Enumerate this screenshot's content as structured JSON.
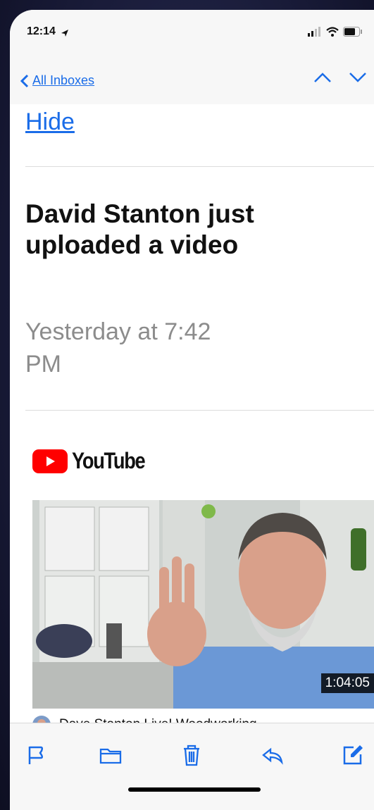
{
  "status_bar": {
    "time": "12:14"
  },
  "nav": {
    "back_label": "All Inboxes"
  },
  "email": {
    "hide_label": "Hide",
    "title": "David Stanton just uploaded a video",
    "date": "Yesterday at 7:42 PM"
  },
  "brand": {
    "name": "YouTube",
    "color": "#ff0000"
  },
  "video": {
    "duration": "1:04:05",
    "channel_text": "Dave Stanton Live! Woodworking,"
  },
  "toolbar": {
    "icons": [
      "flag-icon",
      "folder-icon",
      "trash-icon",
      "reply-icon",
      "compose-icon"
    ]
  },
  "colors": {
    "link": "#1a6ce8",
    "muted": "#8c8c8c",
    "background": "#1b1d3a"
  }
}
